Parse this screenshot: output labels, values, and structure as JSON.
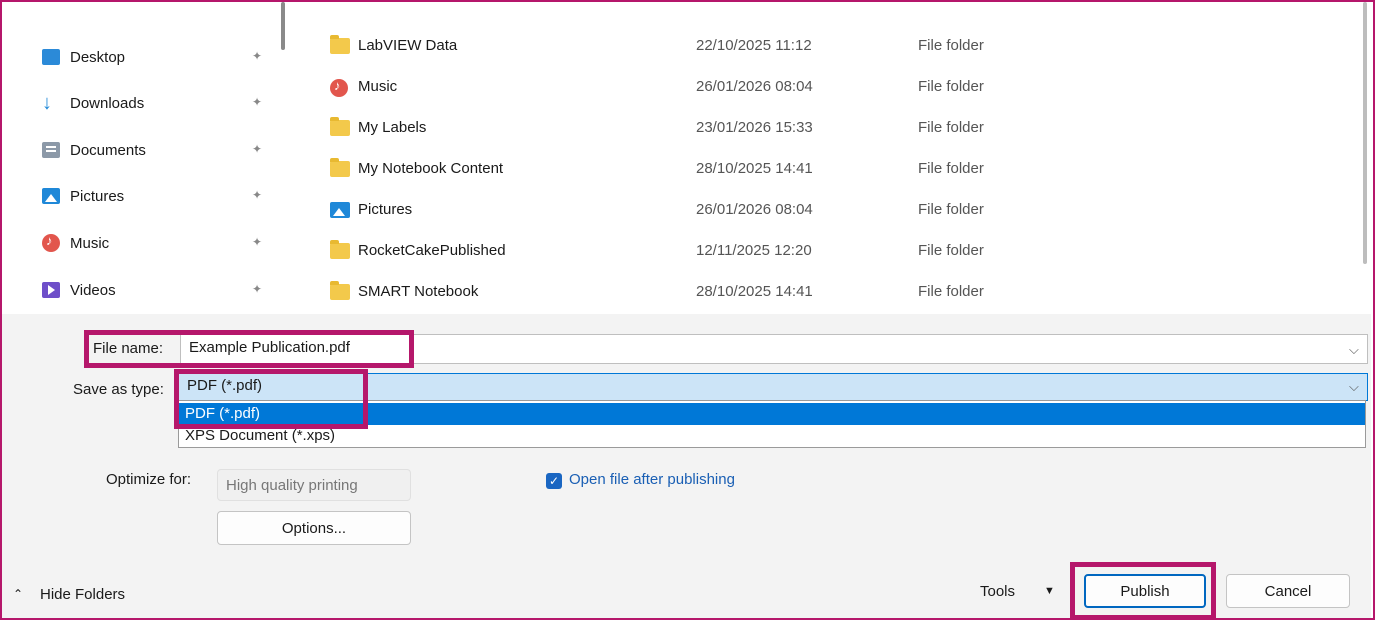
{
  "nav": {
    "items": [
      {
        "label": "Desktop",
        "icon": "desktop-icon"
      },
      {
        "label": "Downloads",
        "icon": "downloads-icon"
      },
      {
        "label": "Documents",
        "icon": "documents-icon"
      },
      {
        "label": "Pictures",
        "icon": "pictures-icon"
      },
      {
        "label": "Music",
        "icon": "music-icon"
      },
      {
        "label": "Videos",
        "icon": "videos-icon"
      }
    ]
  },
  "files": [
    {
      "name": "LabVIEW Data",
      "date": "22/10/2025 11:12",
      "type": "File folder",
      "icon": "folder-icon"
    },
    {
      "name": "Music",
      "date": "26/01/2026 08:04",
      "type": "File folder",
      "icon": "music-icon"
    },
    {
      "name": "My Labels",
      "date": "23/01/2026 15:33",
      "type": "File folder",
      "icon": "folder-icon"
    },
    {
      "name": "My Notebook Content",
      "date": "28/10/2025 14:41",
      "type": "File folder",
      "icon": "folder-icon"
    },
    {
      "name": "Pictures",
      "date": "26/01/2026 08:04",
      "type": "File folder",
      "icon": "pictures-icon"
    },
    {
      "name": "RocketCakePublished",
      "date": "12/11/2025 12:20",
      "type": "File folder",
      "icon": "folder-icon"
    },
    {
      "name": "SMART Notebook",
      "date": "28/10/2025 14:41",
      "type": "File folder",
      "icon": "folder-icon"
    }
  ],
  "form": {
    "file_name_label": "File name:",
    "file_name_value": "Example Publication.pdf",
    "save_type_label": "Save as type:",
    "save_type_value": "PDF (*.pdf)",
    "type_options": [
      "PDF (*.pdf)",
      "XPS Document (*.xps)"
    ],
    "optimize_label": "Optimize for:",
    "optimize_value": "High quality printing",
    "options_button": "Options...",
    "open_after_label": "Open file after publishing",
    "open_after_checked": true
  },
  "footer": {
    "hide_folders": "Hide Folders",
    "tools": "Tools",
    "publish": "Publish",
    "cancel": "Cancel"
  },
  "colors": {
    "highlight": "#b5176b",
    "selection": "#0078d7",
    "dropdown_field": "#cce4f7"
  }
}
